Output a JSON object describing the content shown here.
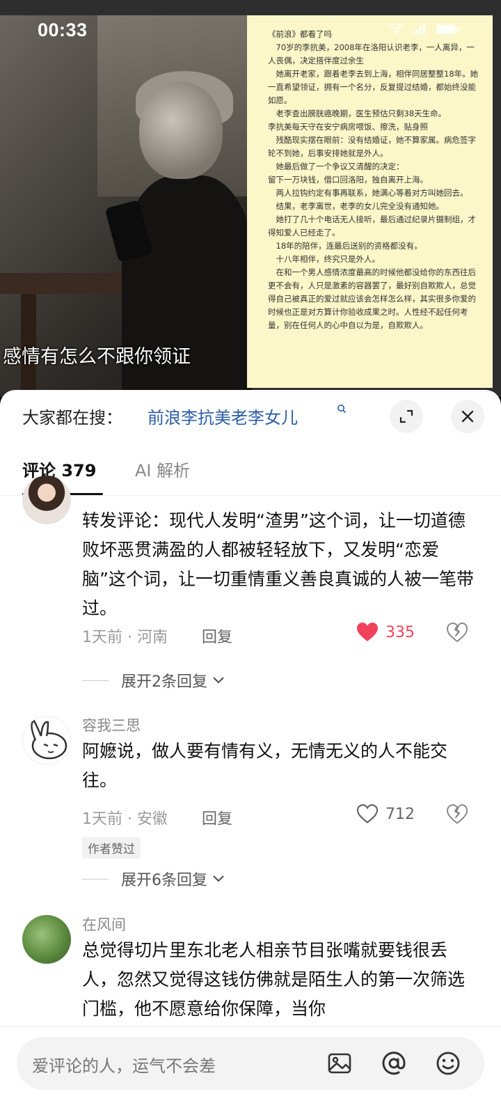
{
  "status_bar": {
    "time": "00:33"
  },
  "video": {
    "subtitle": "感情有怎么不跟你领证",
    "overlay_text": [
      "《前浪》都看了吗",
      "　70岁的李抗美，2008年在洛阳认识老李，一人离异，一人丧偶，决定搭伴度过余生",
      "　她离开老家，跟着老李去到上海，相伴同居整整18年。她一直希望领证，拥有一个名分，反复提过结婚，都始终没能如愿。",
      "　老李查出膀胱癌晚期，医生预估只剩38天生命。",
      "李抗美每天守在安宁病房喂饭、擦洗，贴身照",
      "　残酷现实摆在眼前：没有结婚证，她不算家属。病危签字轮不到她，后事安排她就是外人。",
      "　她最后做了一个争议又清醒的决定：",
      "留下一万块钱，借口回洛阳，独自离开上海。",
      "　两人拉钩约定有事再联系，她满心等着对方叫她回去。",
      "　结果，老李离世，老李的女儿完全没有通知她。",
      "　她打了几十个电话无人接听，最后通过纪录片摄制组，才得知爱人已经走了。",
      "　18年的陪伴，连最后送别的资格都没有。",
      "　十八年相伴，终究只是外人。",
      "　在和一个男人感情浓度最高的时候他都没给你的东西往后更不会有，人只是激素的容器罢了，最好别自欺欺人，总觉得自己被真正的爱过就应该会怎样怎么样，其实很多你爱的时候也正是对方算计你验收成果之时。人性经不起任何考量，别在任何人的心中自以为是，自欺欺人。"
    ]
  },
  "search": {
    "prefix": "大家都在搜：",
    "query": "前浪李抗美老李女儿"
  },
  "tabs": {
    "comments": "评论 379",
    "ai": "AI 解析"
  },
  "comments": [
    {
      "author": "",
      "text": "转发评论：现代人发明“渣男”这个词，让一切道德败坏恶贯满盈的人都被轻轻放下，又发明“恋爱脑”这个词，让一切重情重义善良真诚的人被一笔带过。",
      "meta": "1天前 · 河南",
      "reply": "回复",
      "likes": "335",
      "liked": true,
      "expand": "展开2条回复"
    },
    {
      "author": "容我三思",
      "text": "阿嬷说，做人要有情有义，无情无义的人不能交往。",
      "meta": "1天前 · 安徽",
      "reply": "回复",
      "likes": "712",
      "liked": false,
      "badge": "作者赞过",
      "expand": "展开6条回复"
    },
    {
      "author": "在风间",
      "text": "总觉得切片里东北老人相亲节目张嘴就要钱很丢人，忽然又觉得这钱仿佛就是陌生人的第一次筛选门槛，他不愿意给你保障，当你"
    }
  ],
  "input": {
    "placeholder": "爱评论的人，运气不会差"
  },
  "colors": {
    "link": "#2b5ea8",
    "like": "#f0435b",
    "overlay_bg": "#fbf7c8"
  }
}
